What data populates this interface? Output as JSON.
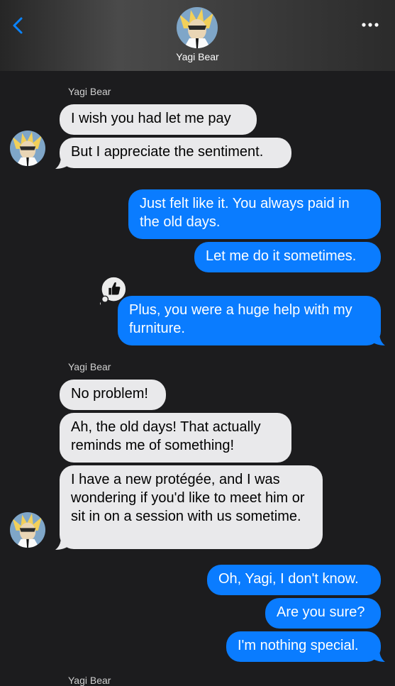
{
  "header": {
    "contact_name": "Yagi Bear",
    "back_icon": "chevron-left-icon",
    "more_icon": "ellipsis-icon"
  },
  "colors": {
    "incoming_bubble": "#e9e9eb",
    "outgoing_bubble": "#0a7cff",
    "background": "#1c1c1e",
    "accent": "#0a84ff"
  },
  "messages": [
    {
      "sender": "Yagi Bear",
      "text": "I wish you had let me pay",
      "direction": "in"
    },
    {
      "text": "But I appreciate the sentiment.",
      "direction": "in"
    },
    {
      "text": "Just felt like it. You always paid in the old days.",
      "direction": "out"
    },
    {
      "text": "Let me do it sometimes.",
      "direction": "out"
    },
    {
      "text": "Plus, you were a huge help with my furniture.",
      "direction": "out",
      "reaction": "thumbs-up-icon"
    },
    {
      "sender": "Yagi Bear",
      "text": "No problem!",
      "direction": "in"
    },
    {
      "text": "Ah, the old days! That actually reminds me of something!",
      "direction": "in"
    },
    {
      "text": "I have a new protégée, and I was wondering if you'd like to meet him or sit in on a session with us sometime.",
      "direction": "in"
    },
    {
      "text": "Oh, Yagi, I don't know.",
      "direction": "out"
    },
    {
      "text": "Are you sure?",
      "direction": "out"
    },
    {
      "text": "I'm nothing special.",
      "direction": "out"
    }
  ],
  "footer_sender": "Yagi Bear"
}
